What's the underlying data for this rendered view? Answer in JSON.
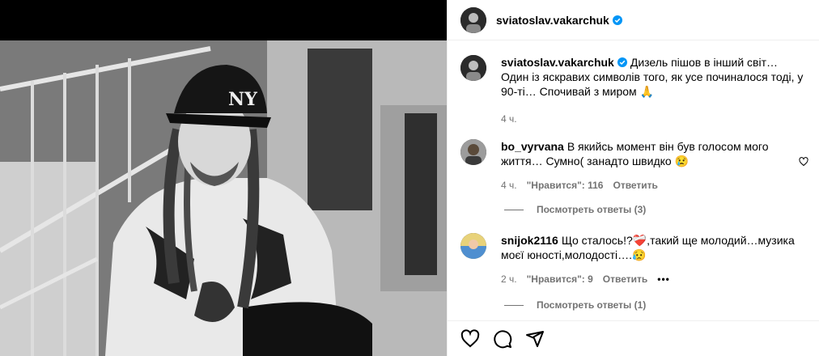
{
  "post": {
    "author": "sviatoslav.vakarchuk",
    "caption": "Дизель пішов в інший світ… Один із яскравих символів того, як усе починалося тоді, у 90-ті… Спочивай з миром 🙏",
    "time": "4 ч."
  },
  "comments": [
    {
      "user": "bo_vyrvana",
      "text": "В якийсь момент він був голосом мого життя… Сумно( занадто швидко 😢",
      "time": "4 ч.",
      "likes": "\"Нравится\": 116",
      "reply": "Ответить",
      "view_replies": "Посмотреть ответы (3)"
    },
    {
      "user": "snijok2116",
      "text": "Що сталось!?❤️‍🩹,такий ще молодий…музика моєї юності,молодості….😥",
      "time": "2 ч.",
      "likes": "\"Нравится\": 9",
      "reply": "Ответить",
      "more": "•••",
      "view_replies": "Посмотреть ответы (1)"
    }
  ],
  "colors": {
    "verified": "#0095f6",
    "meta": "#737373"
  },
  "icons": [
    "verified-badge-icon",
    "heart-icon",
    "comment-icon",
    "share-icon"
  ]
}
